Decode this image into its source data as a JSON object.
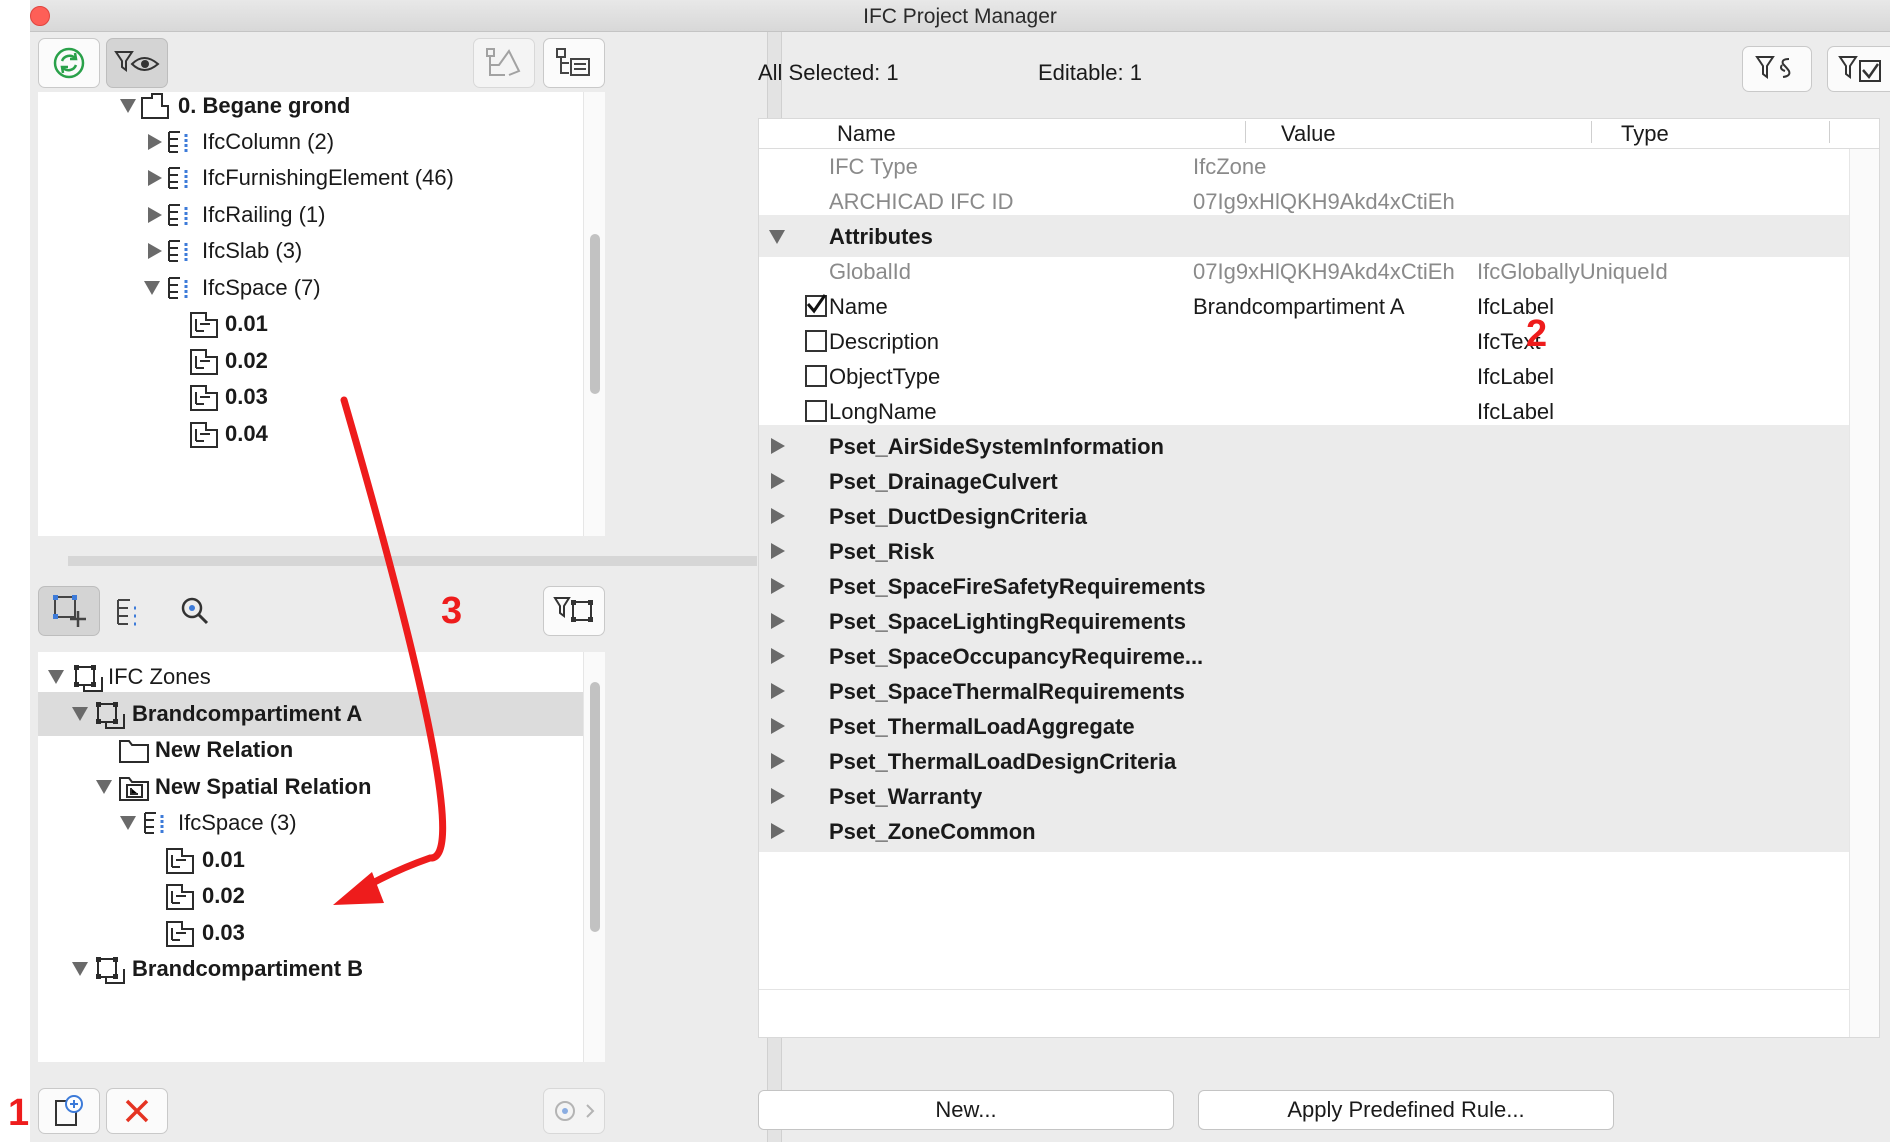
{
  "window": {
    "title": "IFC Project Manager"
  },
  "top_tree": {
    "rows": [
      {
        "label": "0. Begane grond",
        "bold": true
      },
      {
        "label": "IfcColumn (2)"
      },
      {
        "label": "IfcFurnishingElement (46)"
      },
      {
        "label": "IfcRailing (1)"
      },
      {
        "label": "IfcSlab (3)"
      },
      {
        "label": "IfcSpace (7)"
      },
      {
        "label": "0.01"
      },
      {
        "label": "0.02"
      },
      {
        "label": "0.03"
      },
      {
        "label": "0.04"
      }
    ]
  },
  "bottom_tree": {
    "rows": [
      {
        "label": "IFC Zones"
      },
      {
        "label": "Brandcompartiment A"
      },
      {
        "label": "New Relation"
      },
      {
        "label": "New Spatial Relation"
      },
      {
        "label": "IfcSpace (3)"
      },
      {
        "label": "0.01"
      },
      {
        "label": "0.02"
      },
      {
        "label": "0.03"
      },
      {
        "label": "Brandcompartiment B"
      }
    ]
  },
  "right": {
    "all_selected": "All Selected: 1",
    "editable": "Editable: 1",
    "columns": {
      "name": "Name",
      "value": "Value",
      "type": "Type"
    },
    "rows": [
      {
        "name": "IFC Type",
        "value": "IfcZone",
        "type": ""
      },
      {
        "name": "ARCHICAD IFC ID",
        "value": "07Ig9xHlQKH9Akd4xCtiEh",
        "type": ""
      },
      {
        "name": "Attributes"
      },
      {
        "name": "GlobalId",
        "value": "07Ig9xHlQKH9Akd4xCtiEh",
        "type": "IfcGloballyUniqueId"
      },
      {
        "name": "Name",
        "value": "Brandcompartiment A",
        "type": "IfcLabel",
        "checked": true
      },
      {
        "name": "Description",
        "value": "",
        "type": "IfcText",
        "checked": false
      },
      {
        "name": "ObjectType",
        "value": "",
        "type": "IfcLabel",
        "checked": false
      },
      {
        "name": "LongName",
        "value": "",
        "type": "IfcLabel",
        "checked": false
      },
      {
        "name": "Pset_AirSideSystemInformation"
      },
      {
        "name": "Pset_DrainageCulvert"
      },
      {
        "name": "Pset_DuctDesignCriteria"
      },
      {
        "name": "Pset_Risk"
      },
      {
        "name": "Pset_SpaceFireSafetyRequirements"
      },
      {
        "name": "Pset_SpaceLightingRequirements"
      },
      {
        "name": "Pset_SpaceOccupancyRequireme..."
      },
      {
        "name": "Pset_SpaceThermalRequirements"
      },
      {
        "name": "Pset_ThermalLoadAggregate"
      },
      {
        "name": "Pset_ThermalLoadDesignCriteria"
      },
      {
        "name": "Pset_Warranty"
      },
      {
        "name": "Pset_ZoneCommon"
      }
    ],
    "buttons": {
      "new": "New...",
      "apply": "Apply Predefined Rule..."
    }
  },
  "annotations": {
    "one": "1",
    "two": "2",
    "three": "3"
  },
  "colors": {
    "annotation": "#ee1c1c",
    "refresh": "#2aa14a",
    "delete": "#e53322",
    "accent": "#3d7bd9"
  }
}
